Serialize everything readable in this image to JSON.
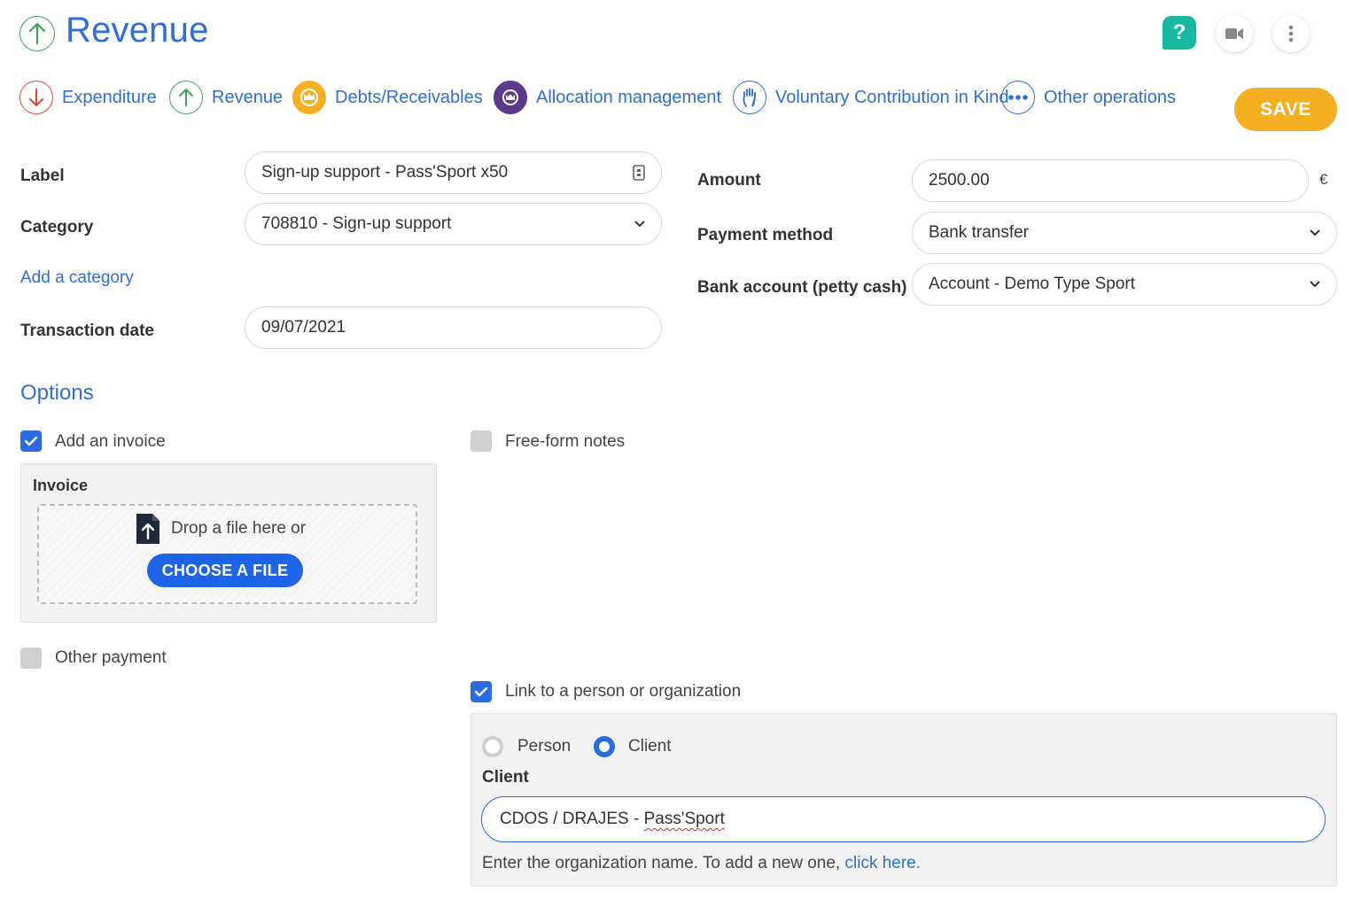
{
  "header": {
    "title": "Revenue",
    "help_label": "?"
  },
  "tabs": [
    {
      "label": "Expenditure",
      "icon": "arrow-down-icon",
      "color": "#e0453a"
    },
    {
      "label": "Revenue",
      "icon": "arrow-up-icon",
      "color": "#3aa55b"
    },
    {
      "label": "Debts/Receivables",
      "icon": "crown-icon",
      "color": "#f4b022"
    },
    {
      "label": "Allocation management",
      "icon": "allocation-crown-icon",
      "color": "#5b3a8c"
    },
    {
      "label": "Voluntary Contribution in Kind",
      "icon": "hand-icon",
      "color": "#2f6fd6"
    },
    {
      "label": "Other operations",
      "icon": "more-dots-icon",
      "color": "#2f6fd6"
    }
  ],
  "save_label": "SAVE",
  "form": {
    "label_label": "Label",
    "label_value": "Sign-up support - Pass'Sport x50",
    "category_label": "Category",
    "category_value": "708810 - Sign-up support",
    "add_category": "Add a category",
    "date_label": "Transaction date",
    "date_value": "09/07/2021",
    "amount_label": "Amount",
    "amount_value": "2500.00",
    "currency": "€",
    "payment_label": "Payment method",
    "payment_value": "Bank transfer",
    "bank_label": "Bank account (petty cash)",
    "bank_value": "Account - Demo Type Sport"
  },
  "options": {
    "title": "Options",
    "add_invoice": "Add an invoice",
    "free_notes": "Free-form notes",
    "invoice_title": "Invoice",
    "drop_text": "Drop a file here or",
    "choose_file": "CHOOSE A FILE",
    "other_payment": "Other payment",
    "link_person": "Link to a person or organization",
    "radio_person": "Person",
    "radio_client": "Client",
    "client_label": "Client",
    "client_value_prefix": "CDOS / DRAJES - ",
    "client_value_suffix": "Pass'Sport",
    "help_text": "Enter the organization name. To add a new one,",
    "help_link": "click here."
  }
}
